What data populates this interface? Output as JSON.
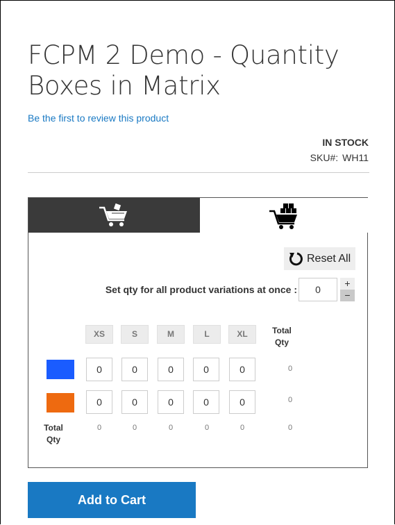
{
  "product": {
    "title": "FCPM 2 Demo - Quantity Boxes in Matrix",
    "review_link": "Be the first to review this product",
    "stock_status": "IN STOCK",
    "sku_label": "SKU#:",
    "sku_value": "WH11"
  },
  "matrix": {
    "tabs": [
      {
        "icon": "cart-with-box-icon",
        "active": false
      },
      {
        "icon": "cart-with-boxes-icon",
        "active": true
      }
    ],
    "reset_label": "Reset All",
    "set_all_label": "Set qty for all product variations at once :",
    "set_all_value": "0",
    "stepper_plus": "+",
    "stepper_minus": "−",
    "sizes": [
      "XS",
      "S",
      "M",
      "L",
      "XL"
    ],
    "total_header": "Total Qty",
    "rows": [
      {
        "color_name": "blue",
        "color": "#1a5cff",
        "values": [
          "0",
          "0",
          "0",
          "0",
          "0"
        ],
        "total": "0"
      },
      {
        "color_name": "orange",
        "color": "#ee6a10",
        "values": [
          "0",
          "0",
          "0",
          "0",
          "0"
        ],
        "total": "0"
      }
    ],
    "total_row_label": "Total Qty",
    "column_totals": [
      "0",
      "0",
      "0",
      "0",
      "0"
    ],
    "grand_total": "0"
  },
  "add_to_cart_label": "Add to Cart"
}
